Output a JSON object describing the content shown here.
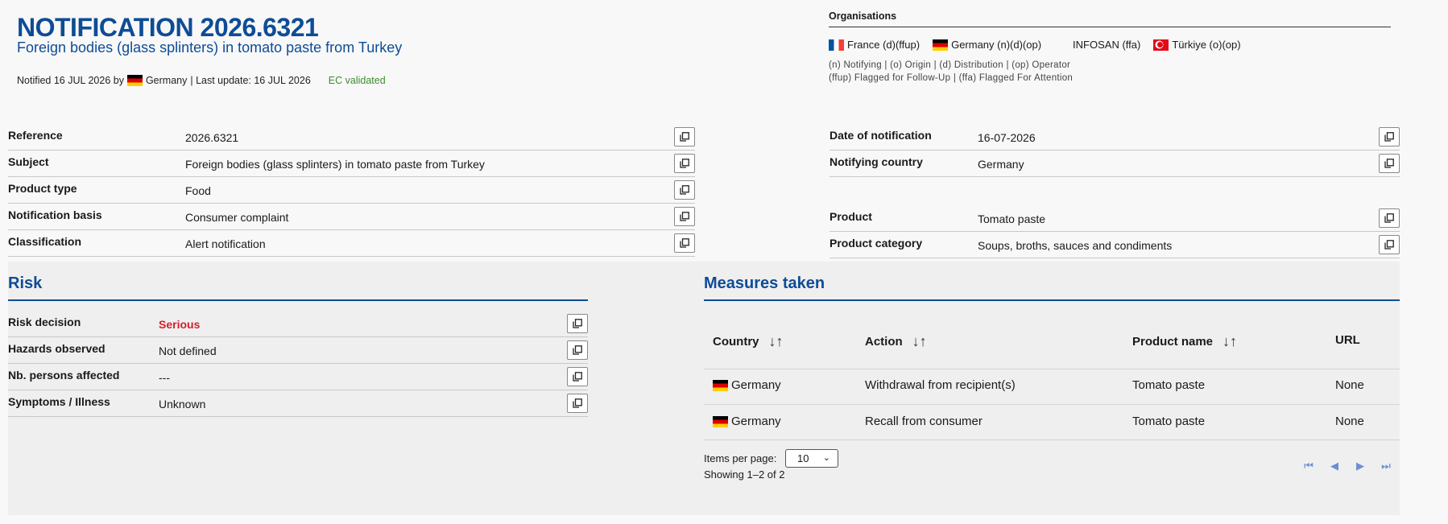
{
  "header": {
    "title": "NOTIFICATION 2026.6321",
    "subtitle": "Foreign bodies (glass splinters) in tomato paste from Turkey",
    "notified_prefix": "Notified 16 JUL 2026 by",
    "notified_country": "Germany",
    "last_update": "| Last update: 16 JUL 2026",
    "validated": "EC validated"
  },
  "organisations": {
    "heading": "Organisations",
    "items": [
      {
        "flag": "fr",
        "label": "France (d)(ffup)"
      },
      {
        "flag": "de",
        "label": "Germany (n)(d)(op)"
      },
      {
        "flag": "none",
        "label": "INFOSAN (ffa)"
      },
      {
        "flag": "tr",
        "label": "Türkiye (o)(op)"
      }
    ],
    "legend_1": "(n) Notifying | (o) Origin | (d) Distribution | (op) Operator",
    "legend_2": "(ffup) Flagged for Follow-Up | (ffa) Flagged For Attention"
  },
  "details_left": [
    {
      "label": "Reference",
      "value": "2026.6321"
    },
    {
      "label": "Subject",
      "value": "Foreign bodies (glass splinters) in tomato paste from Turkey"
    },
    {
      "label": "Product type",
      "value": "Food"
    },
    {
      "label": "Notification basis",
      "value": "Consumer complaint"
    },
    {
      "label": "Classification",
      "value": "Alert notification"
    }
  ],
  "details_right": [
    {
      "label": "Date of notification",
      "value": "16-07-2026"
    },
    {
      "label": "Notifying country",
      "value": "Germany"
    },
    {
      "label": "Product",
      "value": "Tomato paste"
    },
    {
      "label": "Product category",
      "value": "Soups, broths, sauces and condiments"
    }
  ],
  "risk": {
    "title": "Risk",
    "rows": [
      {
        "label": "Risk decision",
        "value": "Serious"
      },
      {
        "label": "Hazards observed",
        "value": "Not defined"
      },
      {
        "label": "Nb. persons affected",
        "value": "---"
      },
      {
        "label": "Symptoms / Illness",
        "value": "Unknown"
      }
    ]
  },
  "measures": {
    "title": "Measures taken",
    "columns": [
      "Country",
      "Action",
      "Product name",
      "URL"
    ],
    "rows": [
      {
        "country": "Germany",
        "action": "Withdrawal from recipient(s)",
        "product": "Tomato paste",
        "url": "None"
      },
      {
        "country": "Germany",
        "action": "Recall from consumer",
        "product": "Tomato paste",
        "url": "None"
      }
    ],
    "items_per_page_label": "Items per page:",
    "items_per_page_value": "10",
    "showing": "Showing 1–2 of 2"
  },
  "icons": {
    "copy": "copy-icon",
    "sort": "sort-icon",
    "chevron": "chevron-down-icon",
    "first": "first-page-icon",
    "prev": "prev-page-icon",
    "next": "next-page-icon",
    "last": "last-page-icon"
  },
  "colors": {
    "brand": "#0e4c96",
    "serious": "#d4202c",
    "validated": "#3d8b2e"
  }
}
